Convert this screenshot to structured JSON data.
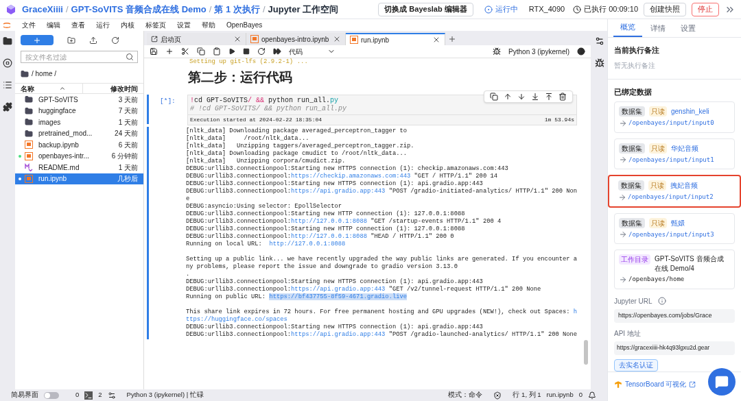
{
  "header": {
    "breadcrumb": [
      {
        "label": "GraceXiiii",
        "current": false
      },
      {
        "label": "GPT-SoVITS 音频合成在线 Demo",
        "current": false
      },
      {
        "label": "第 1 次执行",
        "current": false
      },
      {
        "label": "Jupyter 工作空间",
        "current": true
      }
    ],
    "separator": "/",
    "switch_button": "切换成 Bayeslab 编辑器",
    "status": "运行中",
    "gpu": "RTX_4090",
    "elapsed": "已执行 00:09:10",
    "snapshot_button": "创建快照",
    "stop_button": "停止"
  },
  "menu": [
    "文件",
    "编辑",
    "查看",
    "运行",
    "内核",
    "标签页",
    "设置",
    "帮助",
    "OpenBayes"
  ],
  "file_browser": {
    "filter_placeholder": "按文件名过滤",
    "path": "/ home /",
    "columns": [
      "名称",
      "修改时间"
    ],
    "files": [
      {
        "kind": "folder",
        "name": "GPT-SoVITS",
        "modified": "3 天前",
        "selected": false,
        "running": false
      },
      {
        "kind": "folder",
        "name": "huggingface",
        "modified": "7 天前",
        "selected": false,
        "running": false
      },
      {
        "kind": "folder",
        "name": "images",
        "modified": "1 天前",
        "selected": false,
        "running": false
      },
      {
        "kind": "folder",
        "name": "pretrained_mod...",
        "modified": "24 天前",
        "selected": false,
        "running": false
      },
      {
        "kind": "notebook",
        "name": "backup.ipynb",
        "modified": "6 天前",
        "selected": false,
        "running": false
      },
      {
        "kind": "notebook",
        "name": "openbayes-intr...",
        "modified": "6 分钟前",
        "selected": false,
        "running": true
      },
      {
        "kind": "markdown",
        "name": "README.md",
        "modified": "1 天前",
        "selected": false,
        "running": false
      },
      {
        "kind": "notebook",
        "name": "run.ipynb",
        "modified": "几秒后",
        "selected": true,
        "running": true
      }
    ]
  },
  "tabs": [
    {
      "kind": "launcher",
      "label": "启动页",
      "selected": false
    },
    {
      "kind": "notebook",
      "label": "openbayes-intro.ipynb",
      "selected": false
    },
    {
      "kind": "notebook",
      "label": "run.ipynb",
      "selected": true
    }
  ],
  "toolbar": {
    "cell_type": "代码",
    "kernel": "Python 3 (ipykernel)"
  },
  "notebook": {
    "previous_output": "Setting up git-lfs (2.9.2-1) ...",
    "heading": "第二步：运行代码",
    "prompt": "[*]:",
    "code": [
      [
        {
          "kind": "op",
          "text": "!"
        },
        {
          "kind": "plain",
          "text": "cd GPT-SoVITS"
        },
        {
          "kind": "op",
          "text": "/ &&"
        },
        {
          "kind": "plain",
          "text": " python run_all."
        },
        {
          "kind": "attr",
          "text": "py"
        }
      ],
      [
        {
          "kind": "comment",
          "text": "# !cd GPT-SoVITS/ && python run_all.py"
        }
      ]
    ],
    "execution": "Execution started at 2024-02-22 18:35:04",
    "duration": "1m 53.94s",
    "output": [
      [
        [
          {
            "kind": "plain",
            "text": "[nltk_data] Downloading package averaged_perceptron_tagger to"
          }
        ],
        [
          {
            "kind": "plain",
            "text": "[nltk_data]     /root/nltk_data..."
          }
        ],
        [
          {
            "kind": "plain",
            "text": "[nltk_data]   Unzipping taggers/averaged_perceptron_tagger.zip."
          }
        ],
        [
          {
            "kind": "plain",
            "text": "[nltk_data] Downloading package cmudict to /root/nltk_data..."
          }
        ],
        [
          {
            "kind": "plain",
            "text": "[nltk_data]   Unzipping corpora/cmudict.zip."
          }
        ],
        [
          {
            "kind": "plain",
            "text": "DEBUG:urllib3.connectionpool:Starting new HTTPS connection (1): checkip.amazonaws.com:443"
          }
        ],
        [
          {
            "kind": "plain",
            "text": "DEBUG:urllib3.connectionpool:"
          },
          {
            "kind": "link",
            "text": "https://checkip.amazonaws.com:443"
          },
          {
            "kind": "plain",
            "text": " \"GET / HTTP/1.1\" 200 14"
          }
        ],
        [
          {
            "kind": "plain",
            "text": "DEBUG:urllib3.connectionpool:Starting new HTTPS connection (1): api.gradio.app:443"
          }
        ],
        [
          {
            "kind": "plain",
            "text": "DEBUG:urllib3.connectionpool:"
          },
          {
            "kind": "link",
            "text": "https://api.gradio.app:443"
          },
          {
            "kind": "plain",
            "text": " \"POST /gradio-initiated-analytics/ HTTP/1.1\" 200 Non"
          }
        ],
        [
          {
            "kind": "plain",
            "text": "e"
          }
        ],
        [
          {
            "kind": "plain",
            "text": "DEBUG:asyncio:Using selector: EpollSelector"
          }
        ],
        [
          {
            "kind": "plain",
            "text": "DEBUG:urllib3.connectionpool:Starting new HTTP connection (1): 127.0.0.1:8088"
          }
        ],
        [
          {
            "kind": "plain",
            "text": "DEBUG:urllib3.connectionpool:"
          },
          {
            "kind": "link",
            "text": "http://127.0.0.1:8088"
          },
          {
            "kind": "plain",
            "text": " \"GET /startup-events HTTP/1.1\" 200 4"
          }
        ],
        [
          {
            "kind": "plain",
            "text": "DEBUG:urllib3.connectionpool:Starting new HTTP connection (1): 127.0.0.1:8088"
          }
        ],
        [
          {
            "kind": "plain",
            "text": "DEBUG:urllib3.connectionpool:"
          },
          {
            "kind": "link",
            "text": "http://127.0.0.1:8088"
          },
          {
            "kind": "plain",
            "text": " \"HEAD / HTTP/1.1\" 200 0"
          }
        ],
        [
          {
            "kind": "plain",
            "text": "Running on local URL:  "
          },
          {
            "kind": "link",
            "text": "http://127.0.0.1:8088"
          }
        ]
      ],
      [
        [
          {
            "kind": "plain",
            "text": "Setting up a public link... we have recently upgraded the way public links are generated. If you encounter a"
          }
        ],
        [
          {
            "kind": "plain",
            "text": "ny problems, please report the issue and downgrade to gradio version 3.13.0"
          }
        ],
        [
          {
            "kind": "plain",
            "text": "."
          }
        ],
        [
          {
            "kind": "plain",
            "text": "DEBUG:urllib3.connectionpool:Starting new HTTPS connection (1): api.gradio.app:443"
          }
        ],
        [
          {
            "kind": "plain",
            "text": "DEBUG:urllib3.connectionpool:"
          },
          {
            "kind": "link",
            "text": "https://api.gradio.app:443"
          },
          {
            "kind": "plain",
            "text": " \"GET /v2/tunnel-request HTTP/1.1\" 200 None"
          }
        ],
        [
          {
            "kind": "plain",
            "text": "Running on public URL: "
          },
          {
            "kind": "selected-link",
            "text": "https://bf437755-8f59-4671.gradio.live"
          }
        ]
      ],
      [
        [
          {
            "kind": "plain",
            "text": "This share link expires in 72 hours. For free permanent hosting and GPU upgrades (NEW!), check out Spaces: "
          },
          {
            "kind": "link",
            "text": "h"
          }
        ],
        [
          {
            "kind": "link",
            "text": "ttps://huggingface.co/spaces"
          }
        ],
        [
          {
            "kind": "plain",
            "text": "DEBUG:urllib3.connectionpool:Starting new HTTPS connection (1): api.gradio.app:443"
          }
        ],
        [
          {
            "kind": "plain",
            "text": "DEBUG:urllib3.connectionpool:"
          },
          {
            "kind": "link",
            "text": "https://api.gradio.app:443"
          },
          {
            "kind": "plain",
            "text": " \"POST /gradio-launched-analytics/ HTTP/1.1\" 200 None"
          }
        ]
      ]
    ]
  },
  "status_bar": {
    "simple_mode_label": "简易界面",
    "simple_mode": false,
    "count_1": "0",
    "terminals": "2",
    "kernel_status": "Python 3 (ipykernel) | 忙碌",
    "mode": "模式：命令",
    "position": "行 1, 列 1",
    "file": "run.ipynb",
    "notifications": "0"
  },
  "side_panel": {
    "tabs": [
      {
        "label": "概览",
        "selected": true
      },
      {
        "label": "详情",
        "selected": false
      },
      {
        "label": "设置",
        "selected": false
      }
    ],
    "note_title": "当前执行备注",
    "note_empty": "暂无执行备注",
    "bound_title": "已绑定数据",
    "bindings": [
      {
        "kind": "dataset",
        "tag": "数据集",
        "access": "只读",
        "name": "genshin_keli",
        "path": "/openbayes/input/input0",
        "highlighted": false
      },
      {
        "kind": "dataset",
        "tag": "数据集",
        "access": "只读",
        "name": "华妃音频",
        "path": "/openbayes/input/input1",
        "highlighted": false
      },
      {
        "kind": "dataset",
        "tag": "数据集",
        "access": "只读",
        "name": "拽妃音频",
        "path": "/openbayes/input/input2",
        "highlighted": true
      },
      {
        "kind": "dataset",
        "tag": "数据集",
        "access": "只读",
        "name": "甄嬛",
        "path": "/openbayes/input/input3",
        "highlighted": false
      },
      {
        "kind": "workdir",
        "tag": "工作目录",
        "name": "GPT-SoVITS 音频合成在线 Demo/4",
        "path": "/openbayes/home",
        "highlighted": false
      }
    ],
    "jupyter_url_label": "Jupyter URL",
    "jupyter_url": "https://openbayes.com/jobs/Grace",
    "api_label": "API 地址",
    "api_url": "https://gracexiiii-hk4q93lgxu2d.gear",
    "verify_button": "去实名认证",
    "tensorboard_link": "TensorBoard 可视化"
  }
}
